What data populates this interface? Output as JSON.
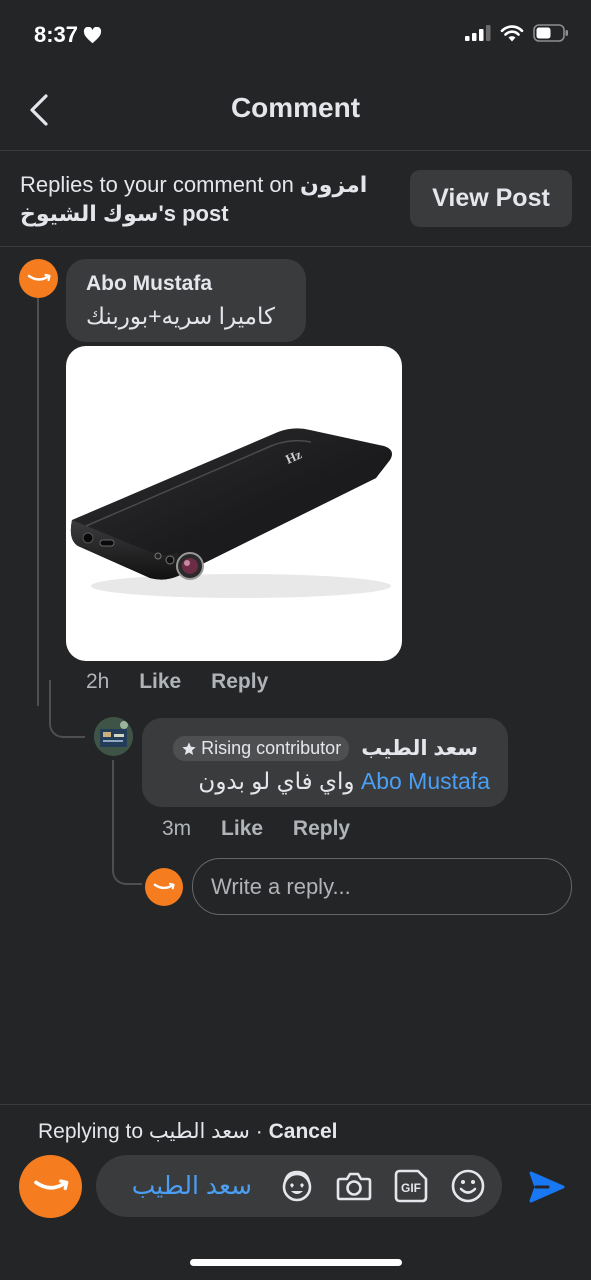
{
  "status": {
    "time": "8:37"
  },
  "header": {
    "title": "Comment"
  },
  "banner": {
    "prefix": "Replies to your comment on ",
    "page_name": "امزون سوك الشيوخ",
    "suffix": "'s post",
    "view_post": "View Post"
  },
  "comment": {
    "author": "Abo Mustafa",
    "text": "كاميرا سريه+بوربنك",
    "time": "2h",
    "like": "Like",
    "reply": "Reply"
  },
  "reply": {
    "author": "سعد الطيب",
    "badge": "Rising contributor",
    "mention": "Abo Mustafa",
    "text": "واي فاي لو بدون",
    "time": "3m",
    "like": "Like",
    "reply": "Reply"
  },
  "reply_box": {
    "placeholder": "Write a reply..."
  },
  "composer": {
    "replying_prefix": "Replying to ",
    "replying_name": "سعد الطيب",
    "separator": " · ",
    "cancel": "Cancel",
    "text": "سعد الطيب",
    "gif": "GIF"
  },
  "colors": {
    "accent": "#4a9ff5",
    "send": "#1877f2",
    "avatar": "#f57c1f",
    "bg": "#242526"
  }
}
